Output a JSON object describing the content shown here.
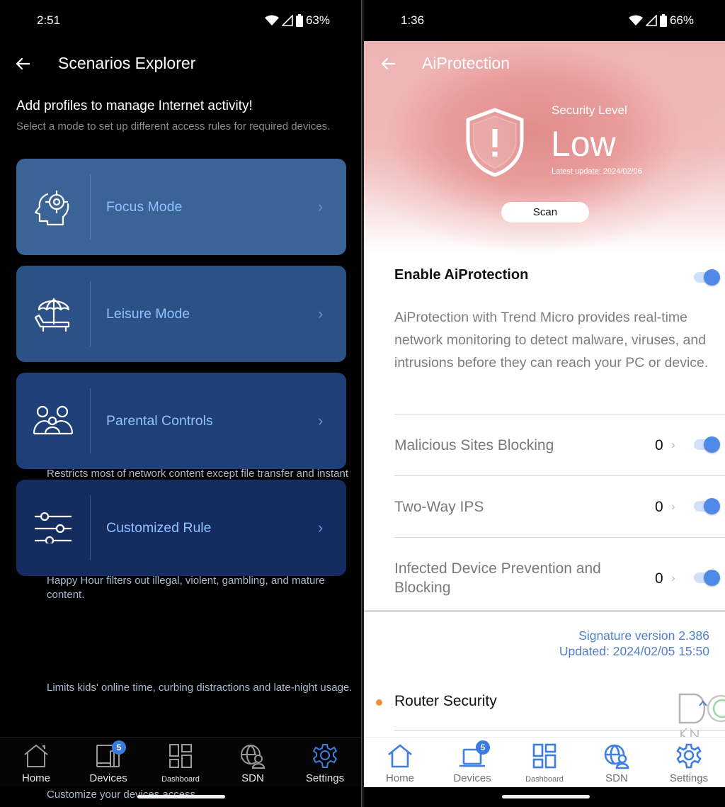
{
  "left": {
    "status": {
      "time": "2:51",
      "battery": "63%"
    },
    "appbar": {
      "title": "Scenarios Explorer"
    },
    "intro": {
      "heading": "Add profiles to manage Internet activity!",
      "subheading": "Select a mode to set up different access rules for required devices."
    },
    "cards": [
      {
        "icon": "focus-head-target-icon",
        "name": "Focus Mode",
        "desc": "Restricts most of network content except file transfer and instant message."
      },
      {
        "icon": "beach-umbrella-chair-icon",
        "name": "Leisure Mode",
        "desc": "Happy Hour filters out illegal, violent, gambling, and mature content."
      },
      {
        "icon": "family-icon",
        "name": "Parental Controls",
        "desc": "Limits kids' online time, curbing distractions and late-night usage."
      },
      {
        "icon": "sliders-icon",
        "name": "Customized Rule",
        "desc": "Customize your devices access."
      }
    ],
    "nav": [
      {
        "label": "Home",
        "icon": "home-icon"
      },
      {
        "label": "Devices",
        "icon": "devices-icon",
        "badge": "5"
      },
      {
        "label": "Dashboard",
        "icon": "dashboard-icon"
      },
      {
        "label": "SDN",
        "icon": "sdn-globe-user-icon"
      },
      {
        "label": "Settings",
        "icon": "gear-icon",
        "active": true
      }
    ]
  },
  "right": {
    "status": {
      "time": "1:36",
      "battery": "66%"
    },
    "appbar": {
      "title": "AiProtection"
    },
    "security": {
      "label": "Security Level",
      "level": "Low",
      "updated": "Latest update: 2024/02/06",
      "scan_label": "Scan"
    },
    "enable": {
      "label": "Enable AiProtection",
      "on": true
    },
    "description": "AiProtection with Trend Micro provides real-time network monitoring to detect malware, viruses, and intrusions before they can reach your PC or device.",
    "features": [
      {
        "label": "Malicious Sites Blocking",
        "count": "0",
        "on": true
      },
      {
        "label": "Two-Way IPS",
        "count": "0",
        "on": true
      },
      {
        "label": "Infected Device Prevention and Blocking",
        "count": "0",
        "on": true
      }
    ],
    "signature": {
      "version": "Signature version 2.386",
      "updated": "Updated: 2024/02/05 15:50"
    },
    "router_security": {
      "label": "Router Security"
    },
    "nav": [
      {
        "label": "Home",
        "icon": "home-icon"
      },
      {
        "label": "Devices",
        "icon": "devices-icon",
        "badge": "5"
      },
      {
        "label": "Dashboard",
        "icon": "dashboard-icon"
      },
      {
        "label": "SDN",
        "icon": "sdn-globe-user-icon"
      },
      {
        "label": "Settings",
        "icon": "gear-icon"
      }
    ]
  },
  "colors": {
    "accent_blue": "#4e8ae6",
    "sig_blue": "#4f7fcf",
    "hero_red": "#e08c8c",
    "router_dot": "#f0923a",
    "card_colors": [
      "#3a6396",
      "#2b5187",
      "#1f3f78",
      "#142c60"
    ]
  }
}
